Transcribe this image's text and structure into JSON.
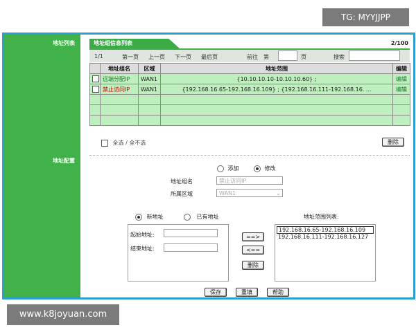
{
  "watermarks": {
    "top": "TG: MYYJJPP",
    "bottom": "www.k8joyuan.com"
  },
  "left_labels": {
    "list": "地址列表",
    "config": "地址配置"
  },
  "list_panel": {
    "tab_title": "地址组信息列表",
    "page_count": "2/100",
    "current_page": "1/1",
    "nav": {
      "first": "第一页",
      "prev": "上一页",
      "next": "下一页",
      "last": "最后页"
    },
    "goto_label": "前往",
    "goto_prefix": "第",
    "goto_suffix": "页",
    "search_label": "搜索",
    "columns": [
      "地址组名",
      "区域",
      "地址范围",
      "编辑"
    ],
    "rows": [
      {
        "name": "远端分配IP",
        "zone": "WAN1",
        "range": "{10.10.10.10-10.10.10.60} ;",
        "edit": "编辑"
      },
      {
        "name": "禁止访问IP",
        "zone": "WAN1",
        "range": "{192.168.16.65-192.168.16.109} ; {192.168.16.111-192.168.16. ...",
        "edit": "编辑"
      }
    ],
    "select_all": "全选 / 全不选",
    "delete_button": "删除"
  },
  "config_panel": {
    "mode_add": "添加",
    "mode_modify": "修改",
    "group_name_label": "地址组名",
    "group_name_value": "禁止访问IP",
    "zone_label": "所属区域",
    "zone_value": "WAN1",
    "new_address": "新地址",
    "existing_address": "已有地址",
    "start_label": "起始地址:",
    "end_label": "结束地址:",
    "add_arrow": "==>",
    "remove_arrow": "<==",
    "delete_button": "删除",
    "range_list_title": "地址范围列表:",
    "range_list": [
      "192.168.16.65-192.168.16.109",
      "192.168.16.111-192.168.16.127"
    ],
    "save": "保存",
    "reset": "重填",
    "help": "帮助"
  },
  "colors": {
    "green": "#41b24a",
    "row_green": "#bfeebf",
    "frame_blue": "#2aa0cf"
  }
}
